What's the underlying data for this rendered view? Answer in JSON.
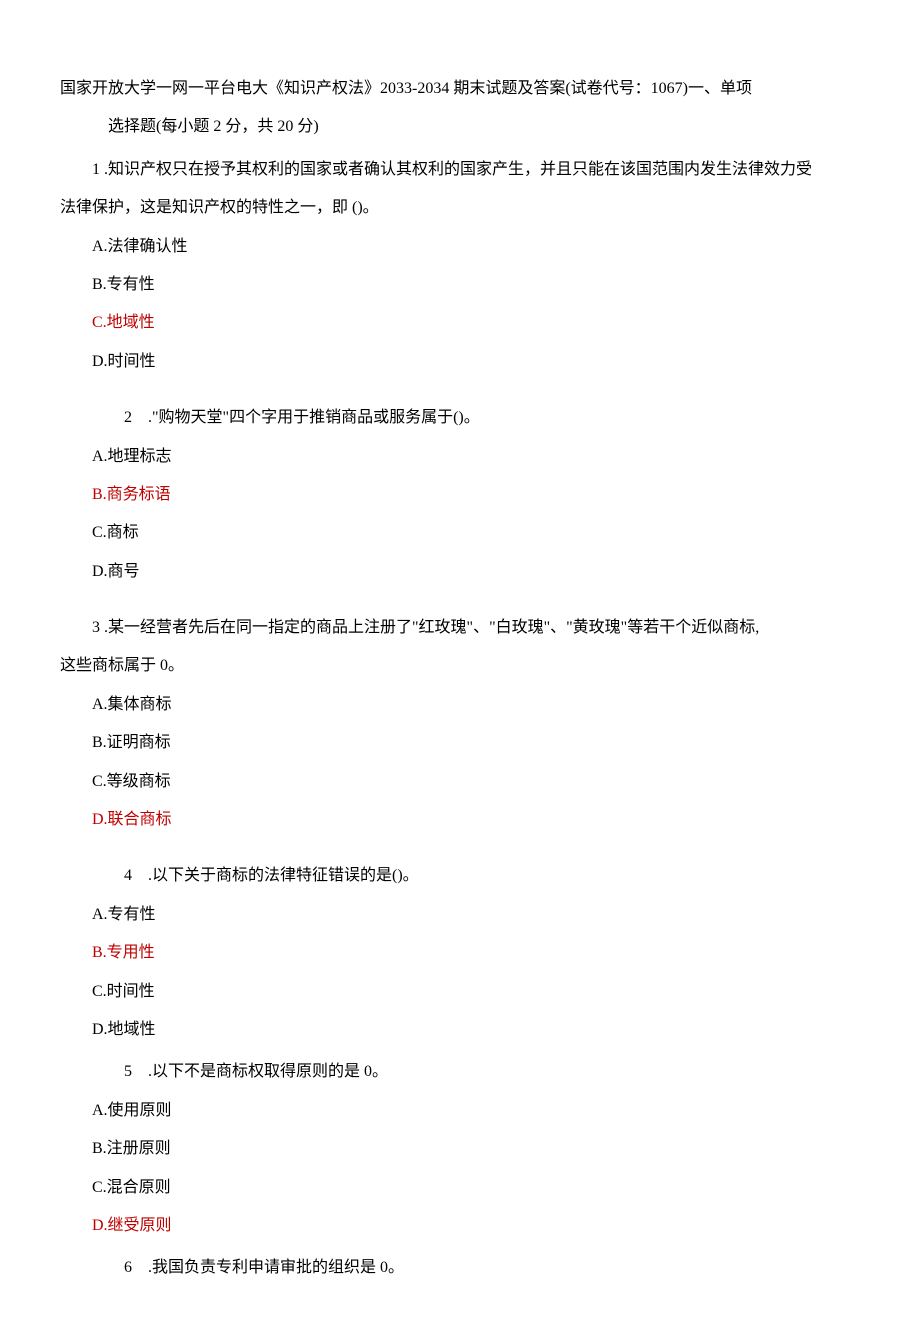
{
  "header": {
    "line1": "国家开放大学一网一平台电大《知识产权法》2033-2034 期末试题及答案(试卷代号：1067)一、单项",
    "line2": "选择题(每小题 2 分，共 20 分)"
  },
  "q1": {
    "text_line1": "1 .知识产权只在授予其权利的国家或者确认其权利的国家产生，并且只能在该国范围内发生法律效力受",
    "text_line2": "法律保护，这是知识产权的特性之一，即 ()。",
    "a": "A.法律确认性",
    "b": "B.专有性",
    "c": "C.地域性",
    "d": "D.时间性"
  },
  "q2": {
    "num": "2",
    "text": ".\"购物天堂\"四个字用于推销商品或服务属于()。",
    "a": "A.地理标志",
    "b": "B.商务标语",
    "c": "C.商标",
    "d": "D.商号"
  },
  "q3": {
    "text_line1": "3 .某一经营者先后在同一指定的商品上注册了\"红玫瑰\"、\"白玫瑰\"、\"黄玫瑰\"等若干个近似商标,",
    "text_line2": "这些商标属于 0。",
    "a": "A.集体商标",
    "b": "B.证明商标",
    "c": "C.等级商标",
    "d": "D.联合商标"
  },
  "q4": {
    "num": "4",
    "text": ".以下关于商标的法律特征错误的是()。",
    "a": "A.专有性",
    "b": "B.专用性",
    "c": "C.时间性",
    "d": "D.地域性"
  },
  "q5": {
    "num": "5",
    "text": ".以下不是商标权取得原则的是 0。",
    "a": "A.使用原则",
    "b": "B.注册原则",
    "c": "C.混合原则",
    "d": "D.继受原则"
  },
  "q6": {
    "num": "6",
    "text": ".我国负责专利申请审批的组织是 0。"
  }
}
